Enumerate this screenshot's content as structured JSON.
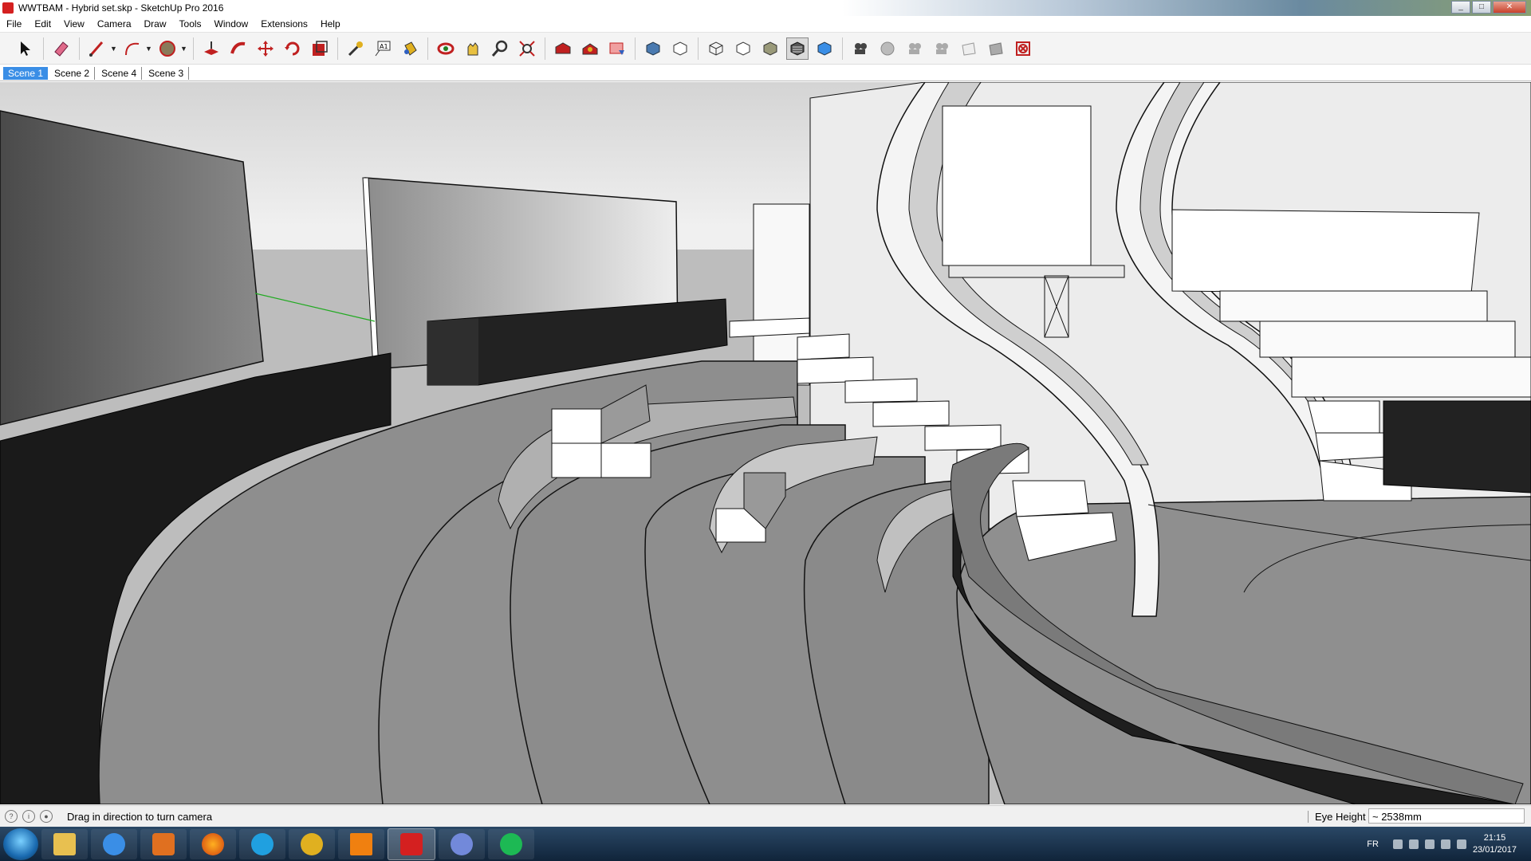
{
  "window": {
    "title": "WWTBAM - Hybrid set.skp - SketchUp Pro 2016"
  },
  "menu": [
    "File",
    "Edit",
    "View",
    "Camera",
    "Draw",
    "Tools",
    "Window",
    "Extensions",
    "Help"
  ],
  "scenes": [
    {
      "label": "Scene 1",
      "active": true
    },
    {
      "label": "Scene 2",
      "active": false
    },
    {
      "label": "Scene 4",
      "active": false
    },
    {
      "label": "Scene 3",
      "active": false
    }
  ],
  "toolbar": {
    "tools": [
      "select-icon",
      "eraser-icon",
      "line-icon",
      "arc-icon",
      "circle-icon",
      "push-pull-icon",
      "follow-me-icon",
      "move-icon",
      "rotate-icon",
      "scale-icon",
      "tape-measure-icon",
      "text-icon",
      "paint-bucket-icon",
      "orbit-icon",
      "pan-icon",
      "zoom-icon",
      "zoom-extents-icon",
      "warehouse-icon",
      "extension-warehouse-icon",
      "layout-icon",
      "xray-icon",
      "back-edges-icon",
      "wireframe-icon",
      "hidden-line-icon",
      "shaded-icon",
      "shaded-textures-icon",
      "monochrome-icon",
      "section-icon-1",
      "section-icon-2",
      "section-icon-3",
      "section-icon-4",
      "section-icon-5",
      "section-icon-6",
      "section-icon-7"
    ],
    "active_tool": "shaded-textures-icon"
  },
  "status": {
    "message": "Drag in direction to turn camera",
    "measurement_label": "Eye Height",
    "measurement_value": "~ 2538mm"
  },
  "taskbar": {
    "apps": [
      "explorer-icon",
      "internet-explorer-icon",
      "media-player-icon",
      "firefox-icon",
      "skype-icon",
      "headphones-icon",
      "vlc-icon",
      "sketchup-icon",
      "discord-icon",
      "spotify-icon"
    ],
    "language": "FR",
    "time": "21:15",
    "date": "23/01/2017"
  },
  "colors": {
    "active_tab": "#3a8ee6",
    "axis_green": "#22aa22"
  }
}
